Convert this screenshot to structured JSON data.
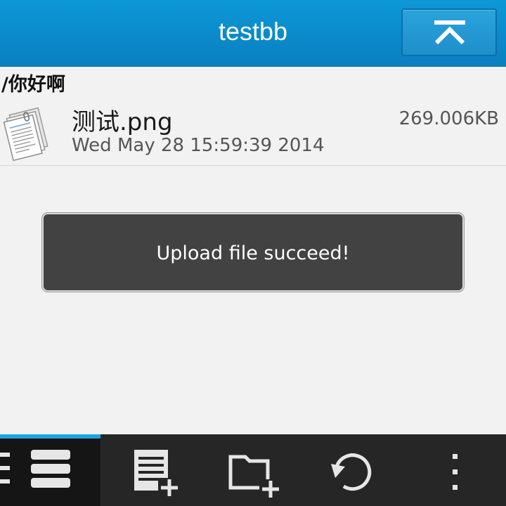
{
  "header": {
    "title": "testbb"
  },
  "breadcrumb": {
    "path": "/你好啊"
  },
  "files": [
    {
      "name": "测试.png",
      "date": "Wed May 28 15:59:39 2014",
      "size": "269.006KB",
      "icon": "document-icon"
    }
  ],
  "toast": {
    "message": "Upload file succeed!"
  },
  "actionbar": {
    "items": [
      {
        "icon": "list-view-icon",
        "active": true
      },
      {
        "icon": "new-file-icon"
      },
      {
        "icon": "new-folder-icon"
      },
      {
        "icon": "refresh-icon"
      },
      {
        "icon": "overflow-menu-icon"
      }
    ]
  },
  "colors": {
    "title_bar": "#0a8ccd",
    "accent": "#1ea4e3",
    "action_bar": "#262626",
    "toast_bg": "#424242",
    "background": "#f2f2f2"
  }
}
